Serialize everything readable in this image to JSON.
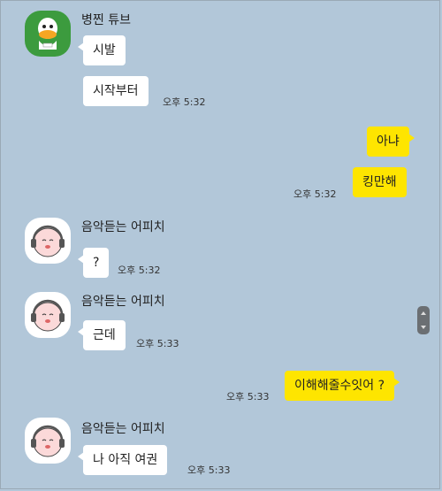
{
  "colors": {
    "background": "#b2c7d9",
    "incoming_bubble": "#ffffff",
    "outgoing_bubble": "#fee500"
  },
  "messages": [
    {
      "sender": "병찐 튜브",
      "avatar_icon": "tube-duck-avatar-icon",
      "bubbles": [
        "시발",
        "시작부터"
      ],
      "time": "오후 5:32"
    },
    {
      "direction": "outgoing",
      "bubbles": [
        "아냐",
        "킹만해"
      ],
      "time": "오후 5:32"
    },
    {
      "sender": "음악듣는 어피치",
      "avatar_icon": "apeach-headphones-avatar-icon",
      "bubbles": [
        "?"
      ],
      "time": "오후 5:32"
    },
    {
      "sender": "음악듣는 어피치",
      "avatar_icon": "apeach-headphones-avatar-icon",
      "bubbles": [
        "근데"
      ],
      "time": "오후 5:33"
    },
    {
      "direction": "outgoing",
      "bubbles": [
        "이해해줄수잇어 ?"
      ],
      "time": "오후 5:33"
    },
    {
      "sender": "음악듣는 어피치",
      "avatar_icon": "apeach-headphones-avatar-icon",
      "bubbles": [
        "나 아직 여권"
      ],
      "time": "오후 5:33"
    }
  ]
}
